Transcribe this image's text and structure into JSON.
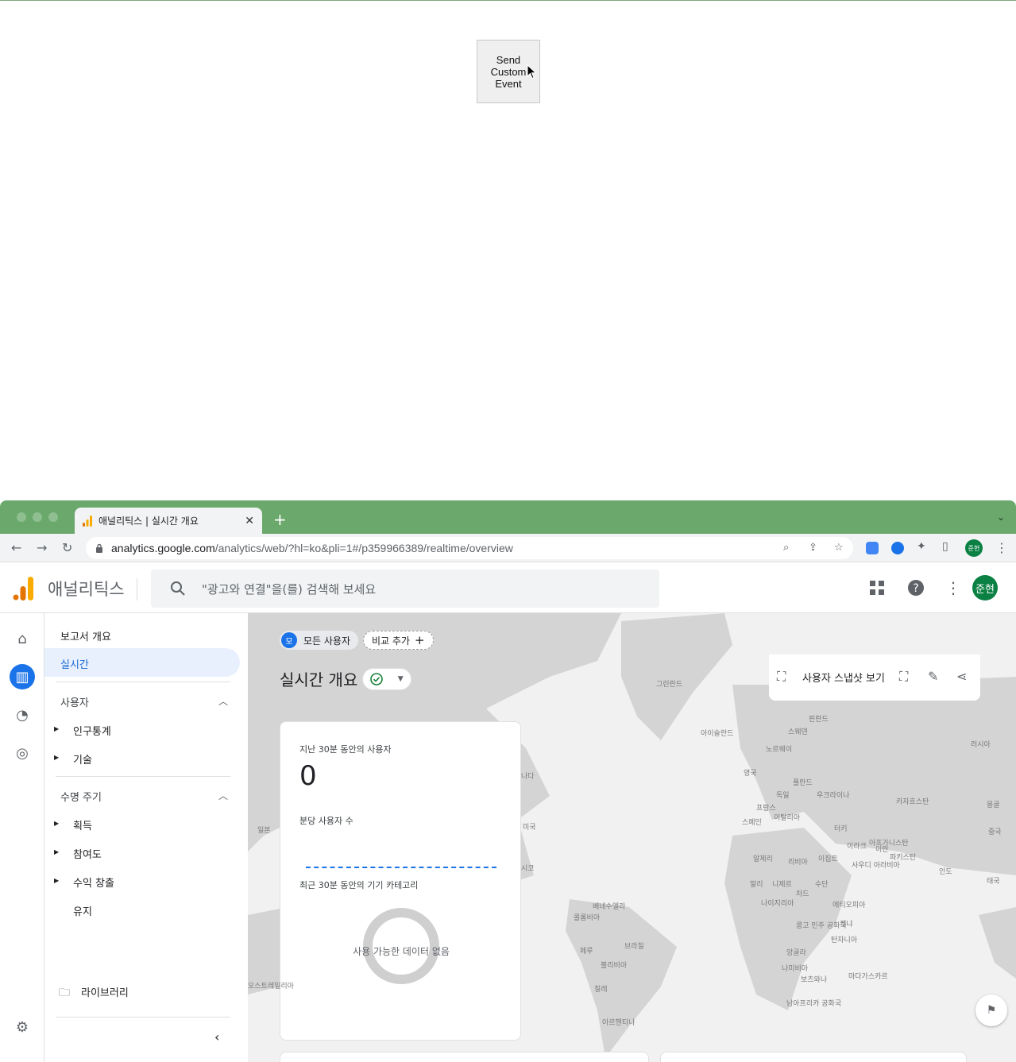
{
  "top_page": {
    "send_button_label": "Send\nCustom\nEvent"
  },
  "browser": {
    "tab_title": "애널리틱스 | 실시간 개요",
    "url_host": "analytics.google.com",
    "url_path": "/analytics/web/?hl=ko&pli=1#/p359966389/realtime/overview",
    "profile_initials": "준현"
  },
  "ga": {
    "app_name": "애널리틱스",
    "search_placeholder": "\"광고와 연결\"을(를) 검색해 보세요",
    "avatar_initials": "준현"
  },
  "nav": {
    "report_overview": "보고서 개요",
    "realtime": "실시간",
    "section_user": "사용자",
    "demographics": "인구통계",
    "tech": "기술",
    "section_lifecycle": "수명 주기",
    "acquisition": "획득",
    "engagement": "참여도",
    "monetization": "수익 창출",
    "retention": "유지",
    "library": "라이브러리"
  },
  "main": {
    "chip_all_users": "모든 사용자",
    "chip_all_users_avatar": "모",
    "chip_add_compare": "비교 추가",
    "title": "실시간 개요",
    "snapshot": "사용자 스냅샷 보기",
    "card": {
      "users_30min_label": "지난 30분 동안의 사용자",
      "users_30min_value": "0",
      "users_per_min_label": "분당 사용자 수",
      "device_label": "최근 30분 동안의 기기 카테고리",
      "no_data": "사용 가능한 데이터 없음"
    }
  },
  "map_labels": [
    "그린란드",
    "아이슬란드",
    "핀란드",
    "스웨덴",
    "노르웨이",
    "러시아",
    "영국",
    "폴란드",
    "우크라이나",
    "독일",
    "카자흐스탄",
    "프랑스",
    "몽골",
    "스페인",
    "이탈리아",
    "중국",
    "터키",
    "이라크",
    "이란",
    "아프가니스탄",
    "파키스탄",
    "알제리",
    "리비아",
    "이집트",
    "사우디 아라비아",
    "인도",
    "말리",
    "니제르",
    "수단",
    "태국",
    "차드",
    "나이지리아",
    "에티오피아",
    "콩고 민주 공화국",
    "케냐",
    "탄자니아",
    "앙골라",
    "나미비아",
    "보츠와나",
    "마다가스카르",
    "남아프리카 공화국",
    "베네수엘라",
    "콜롬비아",
    "페루",
    "브라질",
    "볼리비아",
    "칠레",
    "아르헨티나",
    "나다",
    "미국",
    "시코",
    "일본",
    "오스트레일리아"
  ],
  "colors": {
    "accent": "#1a73e8",
    "tabbar": "#6aa86c",
    "avatar": "#0b8043"
  }
}
